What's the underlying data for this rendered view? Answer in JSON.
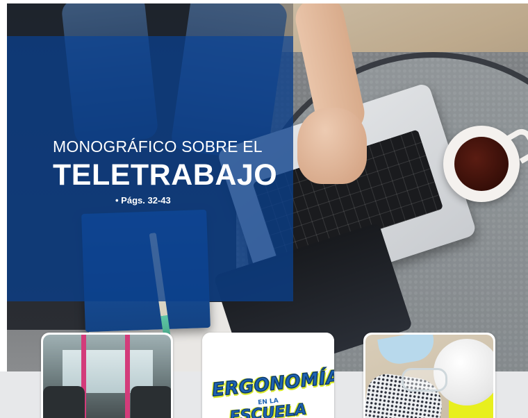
{
  "hero": {
    "eyebrow": "MONOGRÁFICO SOBRE EL",
    "title": "TELETRABAJO",
    "pages": "• Págs. 32-43",
    "overlay_color": "#0a3f8b"
  },
  "cards": [
    {
      "image": "bus-interior"
    },
    {
      "image": "ergonomia-logo",
      "logo_text": "ERGONOMÍA",
      "logo_sub": "EN LA",
      "logo_text_2": "ESCUELA"
    },
    {
      "image": "safety-gear"
    }
  ],
  "colors": {
    "band": "#e7e8ea",
    "accent_yellow": "#d8e92a",
    "accent_blue": "#1e63b3"
  }
}
